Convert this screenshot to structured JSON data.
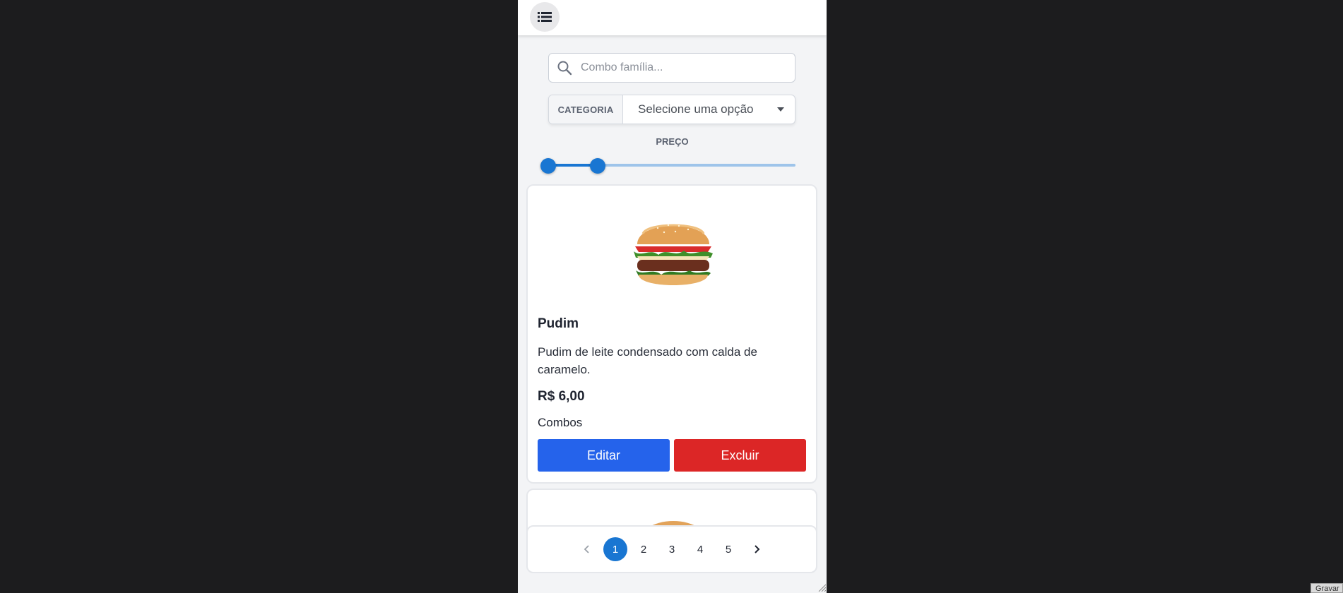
{
  "search": {
    "placeholder": "Combo família..."
  },
  "filters": {
    "category_label": "CATEGORIA",
    "category_selected": "Selecione uma opção",
    "price_label": "PREÇO",
    "price_range": [
      0,
      0.2
    ]
  },
  "product": {
    "name": "Pudim",
    "description": "Pudim de leite condensado com calda de caramelo.",
    "price": "R$ 6,00",
    "category": "Combos",
    "image": "burger",
    "edit_label": "Editar",
    "delete_label": "Excluir"
  },
  "pagination": {
    "pages": [
      "1",
      "2",
      "3",
      "4",
      "5"
    ],
    "current": "1"
  },
  "corner_button": {
    "label": "Gravar"
  },
  "colors": {
    "primary": "#1976d2",
    "edit": "#2563eb",
    "delete": "#dc2626"
  }
}
